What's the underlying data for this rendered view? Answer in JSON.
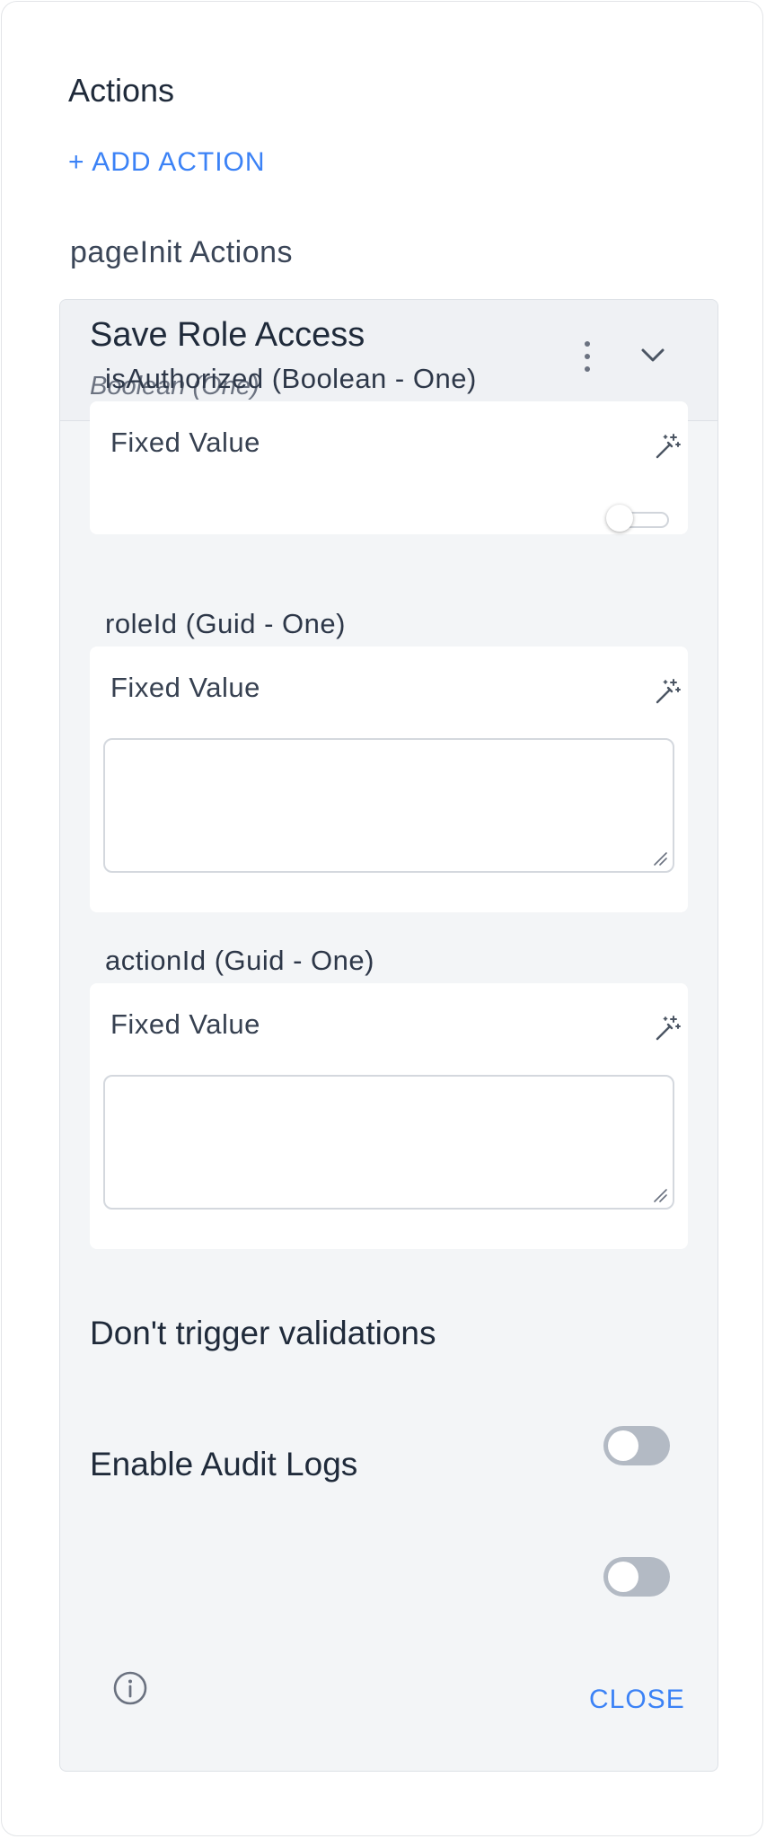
{
  "panel": {
    "title": "Actions",
    "add_action_label": "+ ADD ACTION",
    "section_title": "pageInit Actions"
  },
  "action_card": {
    "title": "Save Role Access",
    "subtitle": "Boolean (One)",
    "parameters": [
      {
        "label": "isAuthorized (Boolean - One)",
        "mode": "Fixed Value",
        "input_type": "toggle",
        "value": false
      },
      {
        "label": "roleId (Guid - One)",
        "mode": "Fixed Value",
        "input_type": "textarea",
        "value": ""
      },
      {
        "label": "actionId (Guid - One)",
        "mode": "Fixed Value",
        "input_type": "textarea",
        "value": ""
      }
    ],
    "options": [
      {
        "label": "Don't trigger validations",
        "enabled": false
      },
      {
        "label": "Enable Audit Logs",
        "enabled": false
      }
    ],
    "close_label": "CLOSE"
  },
  "icons": {
    "menu": "kebab-menu-icon",
    "collapse": "chevron-down-icon",
    "fixed_value": "magic-wand-icon",
    "info": "info-icon"
  },
  "colors": {
    "accent": "#3b82f6",
    "card_bg": "#f3f5f7",
    "toggle_off": "#b3bac4"
  }
}
